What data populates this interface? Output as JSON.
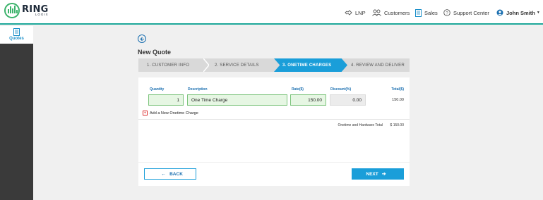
{
  "brand": {
    "name": "RING",
    "sub": "LOGIX"
  },
  "header": {
    "nav": [
      {
        "label": "LNP",
        "icon": "handshake-icon"
      },
      {
        "label": "Customers",
        "icon": "customers-icon"
      },
      {
        "label": "Sales",
        "icon": "document-icon"
      },
      {
        "label": "Support Center",
        "icon": "help-icon"
      }
    ],
    "user": {
      "name": "John Smith",
      "icon": "user-circle-icon"
    }
  },
  "sidebar": {
    "items": [
      {
        "label": "Quotes",
        "icon": "quote-doc-icon",
        "active": true
      }
    ]
  },
  "page": {
    "title": "New Quote"
  },
  "wizard": {
    "steps": [
      "1. CUSTOMER INFO",
      "2. SERVICE DETAILS",
      "3. ONETIME CHARGES",
      "4. REVIEW AND DELIVER"
    ],
    "active_index": 2
  },
  "charges": {
    "columns": {
      "quantity": "Quantity",
      "description": "Description",
      "rate": "Rate($)",
      "discount": "Discount(%)",
      "total": "Total($)"
    },
    "row": {
      "quantity": "1",
      "description": "One Time Charge",
      "rate": "150.00",
      "discount": "0.00",
      "total": "150.00"
    },
    "add_label": "Add a New Onetime Charge",
    "grand_total_label": "Onetime and Hardware Total",
    "grand_total_value": "$ 150.00"
  },
  "footer": {
    "back_label": "BACK",
    "next_label": "NEXT"
  },
  "colors": {
    "accent": "#1a9ed9",
    "brand_green": "#3cb36b",
    "sidebar": "#3a3a3a",
    "field_ok": "#e6f6e3"
  }
}
